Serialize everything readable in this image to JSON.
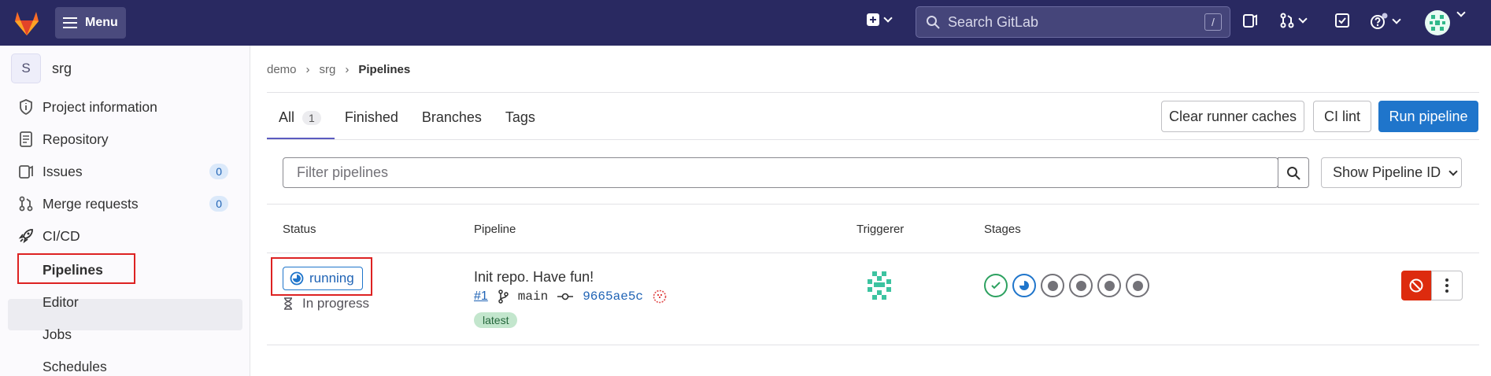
{
  "topbar": {
    "menu_label": "Menu",
    "search_placeholder": "Search GitLab",
    "search_shortcut": "/"
  },
  "sidebar": {
    "project_initial": "S",
    "project_name": "srg",
    "items": [
      {
        "label": "Project information",
        "icon": "info-icon"
      },
      {
        "label": "Repository",
        "icon": "doc-icon"
      },
      {
        "label": "Issues",
        "icon": "issues-icon",
        "count": "0"
      },
      {
        "label": "Merge requests",
        "icon": "merge-request-icon",
        "count": "0"
      },
      {
        "label": "CI/CD",
        "icon": "rocket-icon"
      }
    ],
    "sub_items": [
      "Pipelines",
      "Editor",
      "Jobs",
      "Schedules"
    ]
  },
  "breadcrumb": [
    "demo",
    "srg",
    "Pipelines"
  ],
  "tabs": [
    {
      "label": "All",
      "count": "1"
    },
    {
      "label": "Finished"
    },
    {
      "label": "Branches"
    },
    {
      "label": "Tags"
    }
  ],
  "actions": {
    "clear_caches": "Clear runner caches",
    "ci_lint": "CI lint",
    "run_pipeline": "Run pipeline"
  },
  "filter": {
    "placeholder": "Filter pipelines",
    "show_id": "Show Pipeline ID"
  },
  "table": {
    "headers": [
      "Status",
      "Pipeline",
      "Triggerer",
      "Stages"
    ],
    "rows": [
      {
        "status": "running",
        "duration": "In progress",
        "title": "Init repo. Have fun!",
        "id": "#1",
        "branch": "main",
        "commit": "9665ae5c",
        "tag": "latest",
        "stages": [
          "success",
          "running",
          "pending",
          "pending",
          "pending",
          "pending"
        ]
      }
    ]
  },
  "colors": {
    "topbar": "#292961",
    "primary": "#1f75cb",
    "danger": "#dd2b0e",
    "success": "#2da160"
  }
}
